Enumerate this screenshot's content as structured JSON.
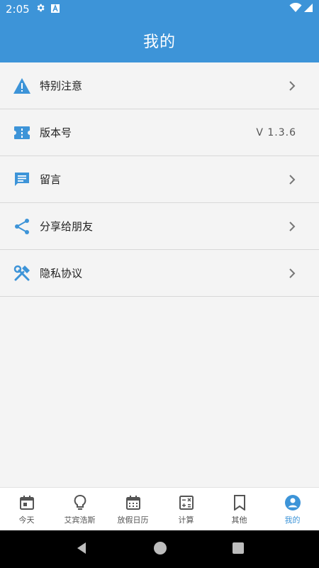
{
  "status_bar": {
    "time": "2:05",
    "icons": [
      "gear-icon",
      "a-badge-icon",
      "wifi-icon",
      "signal-icon"
    ]
  },
  "app_bar": {
    "title": "我的"
  },
  "menu": [
    {
      "label": "特别注意",
      "icon": "warning-icon",
      "trailing": "chevron"
    },
    {
      "label": "版本号",
      "icon": "ticket-icon",
      "trailing": "text",
      "value": "V 1.3.6"
    },
    {
      "label": "留言",
      "icon": "message-icon",
      "trailing": "chevron"
    },
    {
      "label": "分享给朋友",
      "icon": "share-icon",
      "trailing": "chevron"
    },
    {
      "label": "隐私协议",
      "icon": "tools-icon",
      "trailing": "chevron"
    }
  ],
  "bottom_nav": [
    {
      "label": "今天",
      "icon": "calendar-day-icon",
      "active": false
    },
    {
      "label": "艾宾浩斯",
      "icon": "lightbulb-icon",
      "active": false
    },
    {
      "label": "放假日历",
      "icon": "calendar-icon",
      "active": false
    },
    {
      "label": "计算",
      "icon": "calculator-icon",
      "active": false
    },
    {
      "label": "其他",
      "icon": "bookmark-icon",
      "active": false
    },
    {
      "label": "我的",
      "icon": "account-icon",
      "active": true
    }
  ],
  "colors": {
    "primary": "#3d94d8",
    "background": "#f4f4f4",
    "text": "#222222"
  }
}
